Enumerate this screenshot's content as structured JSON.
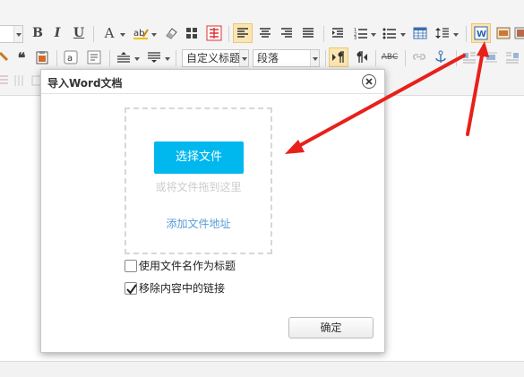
{
  "toolbar": {
    "font_size_value": "",
    "custom_title_select": "自定义标题",
    "paragraph_select": "段落",
    "abc_label": "ABC",
    "icons": [
      "bold-icon",
      "italic-icon",
      "underline-icon",
      "font-color-icon",
      "highlight-icon",
      "eraser-icon",
      "table-grid-icon",
      "special-char-icon",
      "align-left-icon",
      "align-center-icon",
      "align-right-icon",
      "align-justify-icon",
      "indent-icon",
      "ordered-list-icon",
      "unordered-list-icon",
      "insert-table-icon",
      "line-height-icon",
      "import-word-icon",
      "image-icon",
      "media-icon"
    ]
  },
  "dialog": {
    "title": "导入Word文档",
    "pick_button": "选择文件",
    "drop_hint": "或将文件拖到这里",
    "add_link": "添加文件地址",
    "option_filename_title": "使用文件名作为标题",
    "option_filename_title_checked": false,
    "option_remove_links": "移除内容中的链接",
    "option_remove_links_checked": true,
    "confirm_button": "确定"
  },
  "colors": {
    "primary_button": "#00b7ee",
    "link": "#5a9bd6",
    "annotation_arrow": "#e8201b",
    "active_toolbar": "#fbe6b1"
  }
}
